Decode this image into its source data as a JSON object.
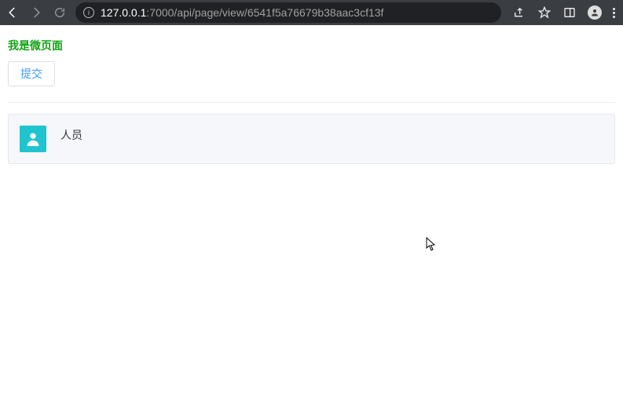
{
  "browser": {
    "url_host": "127.0.0.1",
    "url_path": ":7000/api/page/view/6541f5a76679b38aac3cf13f"
  },
  "header": {
    "title": "我是微页面"
  },
  "actions": {
    "submit_label": "提交"
  },
  "card": {
    "label": "人员"
  }
}
